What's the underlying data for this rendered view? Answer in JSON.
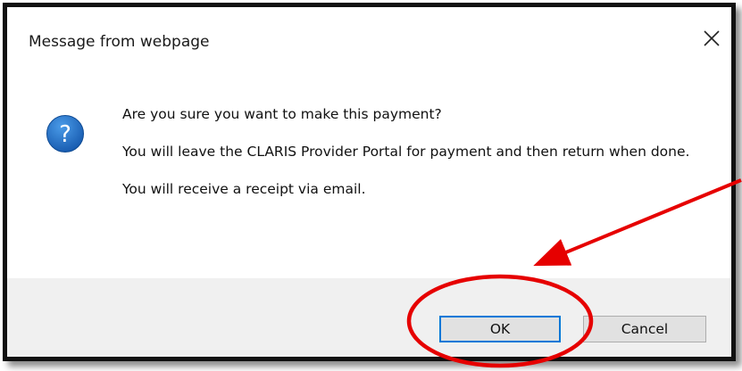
{
  "dialog": {
    "title": "Message from webpage",
    "close_icon": "close-icon",
    "icon": "question-icon",
    "icon_color": "#1f6fc5",
    "messages": [
      "Are you sure you want to make this payment?",
      "You will leave the CLARIS Provider Portal for payment and then return when done.",
      "You will receive a receipt via email."
    ],
    "buttons": {
      "ok_label": "OK",
      "cancel_label": "Cancel"
    }
  },
  "annotation": {
    "color": "#e60000",
    "shapes": [
      "ellipse-highlight",
      "arrow"
    ]
  }
}
